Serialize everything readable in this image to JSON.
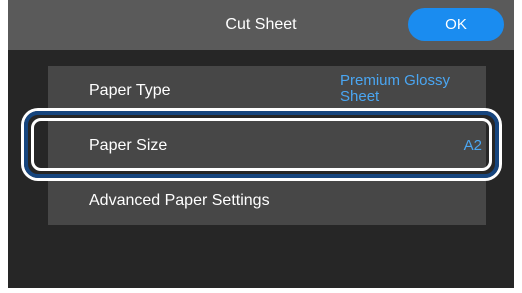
{
  "header": {
    "title": "Cut Sheet",
    "ok_label": "OK"
  },
  "settings": [
    {
      "label": "Paper Type",
      "value_line1": "Premium Glossy",
      "value_line2": "Sheet"
    },
    {
      "label": "Paper Size",
      "value": "A2"
    },
    {
      "label": "Advanced Paper Settings"
    }
  ],
  "colors": {
    "screen_bg": "#262626",
    "title_bar": "#5a5a5a",
    "row_bg": "#474747",
    "accent_blue": "#1a8cf0",
    "value_blue": "#4aa6f2",
    "highlight_outline": "#16457e"
  }
}
